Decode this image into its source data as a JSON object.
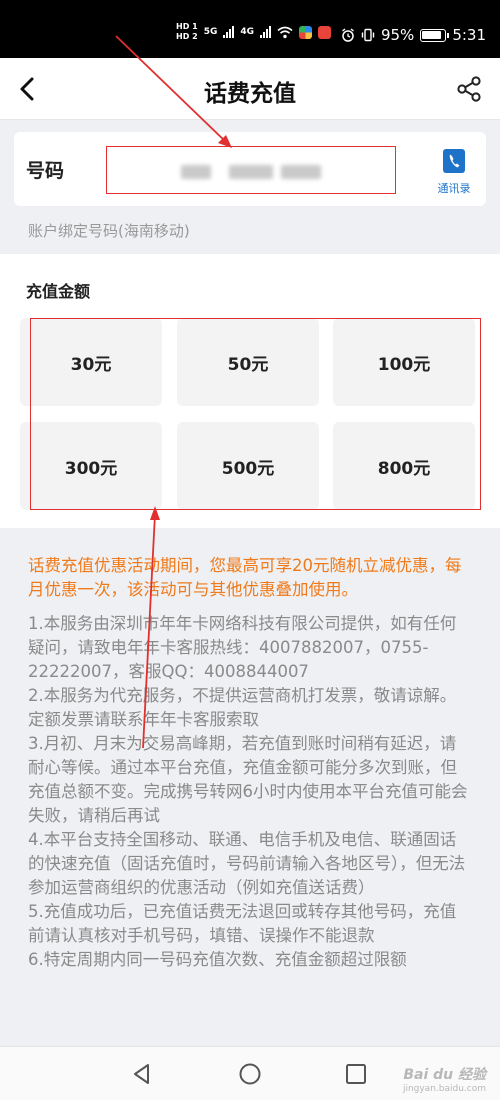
{
  "status_bar": {
    "hd1": "HD 1",
    "hd2": "HD 2",
    "net1": "5G",
    "net2": "4G",
    "battery": "95%",
    "time": "5:31"
  },
  "nav": {
    "title": "话费充值",
    "back_icon": "chevron-left-icon",
    "share_icon": "share-icon"
  },
  "number_field": {
    "label": "号码",
    "value": "",
    "contacts_icon": "phone-book-icon",
    "contacts_label": "通讯录"
  },
  "account_note": "账户绑定号码(海南移动)",
  "amount": {
    "title": "充值金额",
    "options": [
      "30元",
      "50元",
      "100元",
      "300元",
      "500元",
      "800元"
    ]
  },
  "promo_text": "话费充值优惠活动期间，您最高可享20元随机立减优惠，每月优惠一次，该活动可与其他优惠叠加使用。",
  "rules": [
    "1.本服务由深圳市年年卡网络科技有限公司提供，如有任何疑问，请致电年年卡客服热线：4007882007，0755-22222007，客服QQ：4008844007",
    "2.本服务为代充服务，不提供运营商机打发票，敬请谅解。定额发票请联系年年卡客服索取",
    "3.月初、月末为交易高峰期，若充值到账时间稍有延迟，请耐心等候。通过本平台充值，充值金额可能分多次到账，但充值总额不变。完成携号转网6小时内使用本平台充值可能会失败，请稍后再试",
    "4.本平台支持全国移动、联通、电信手机及电信、联通固话的快速充值（固话充值时，号码前请输入各地区号），但无法参加运营商组织的优惠活动（例如充值送话费）",
    "5.充值成功后，已充值话费无法退回或转存其他号码，充值前请认真核对手机号码，填错、误操作不能退款",
    "6.特定周期内同一号码充值次数、充值金额超过限额"
  ],
  "system_nav": {
    "back_icon": "triangle-back-icon",
    "home_icon": "circle-home-icon",
    "recents_icon": "square-recents-icon"
  },
  "watermark": {
    "main": "Bai du 经验",
    "sub": "jingyan.baidu.com"
  },
  "colors": {
    "accent_orange": "#f07a1a",
    "annotation_red": "#e03030",
    "link_blue": "#1e73c9",
    "rules_gray": "#8a8a8a"
  }
}
